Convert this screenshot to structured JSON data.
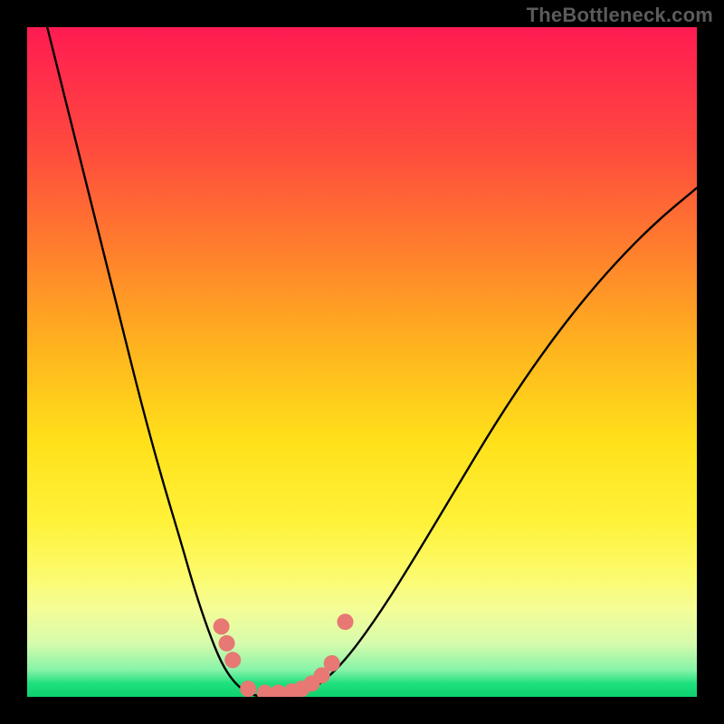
{
  "watermark": "TheBottleneck.com",
  "chart_data": {
    "type": "line",
    "title": "",
    "xlabel": "",
    "ylabel": "",
    "xlim": [
      0,
      100
    ],
    "ylim": [
      0,
      100
    ],
    "curve": {
      "name": "bottleneck-curve",
      "points": [
        {
          "x": 3,
          "y": 100
        },
        {
          "x": 5,
          "y": 92
        },
        {
          "x": 8,
          "y": 80
        },
        {
          "x": 11,
          "y": 68
        },
        {
          "x": 14,
          "y": 56
        },
        {
          "x": 17,
          "y": 44
        },
        {
          "x": 20,
          "y": 33
        },
        {
          "x": 23,
          "y": 23
        },
        {
          "x": 25,
          "y": 16
        },
        {
          "x": 27,
          "y": 10
        },
        {
          "x": 29,
          "y": 5
        },
        {
          "x": 31,
          "y": 2
        },
        {
          "x": 33,
          "y": 0.5
        },
        {
          "x": 35,
          "y": 0
        },
        {
          "x": 38,
          "y": 0
        },
        {
          "x": 41,
          "y": 0.5
        },
        {
          "x": 44,
          "y": 2
        },
        {
          "x": 48,
          "y": 6
        },
        {
          "x": 53,
          "y": 13
        },
        {
          "x": 58,
          "y": 21
        },
        {
          "x": 64,
          "y": 31
        },
        {
          "x": 70,
          "y": 41
        },
        {
          "x": 76,
          "y": 50
        },
        {
          "x": 82,
          "y": 58
        },
        {
          "x": 88,
          "y": 65
        },
        {
          "x": 94,
          "y": 71
        },
        {
          "x": 100,
          "y": 76
        }
      ]
    },
    "markers": {
      "name": "highlight-dots",
      "color": "#e77873",
      "points": [
        {
          "x": 29.0,
          "y": 10.5
        },
        {
          "x": 29.8,
          "y": 8.0
        },
        {
          "x": 30.7,
          "y": 5.5
        },
        {
          "x": 33.0,
          "y": 1.2
        },
        {
          "x": 35.5,
          "y": 0.6
        },
        {
          "x": 37.5,
          "y": 0.6
        },
        {
          "x": 39.5,
          "y": 0.8
        },
        {
          "x": 41.0,
          "y": 1.2
        },
        {
          "x": 42.5,
          "y": 2.0
        },
        {
          "x": 44.0,
          "y": 3.2
        },
        {
          "x": 45.5,
          "y": 5.0
        },
        {
          "x": 47.5,
          "y": 11.2
        }
      ]
    },
    "gradient_bands": [
      {
        "at": 0,
        "meaning": "worst",
        "color": "#ff1b52"
      },
      {
        "at": 50,
        "meaning": "mid",
        "color": "#ffe11a"
      },
      {
        "at": 100,
        "meaning": "best",
        "color": "#0dd26f"
      }
    ]
  }
}
